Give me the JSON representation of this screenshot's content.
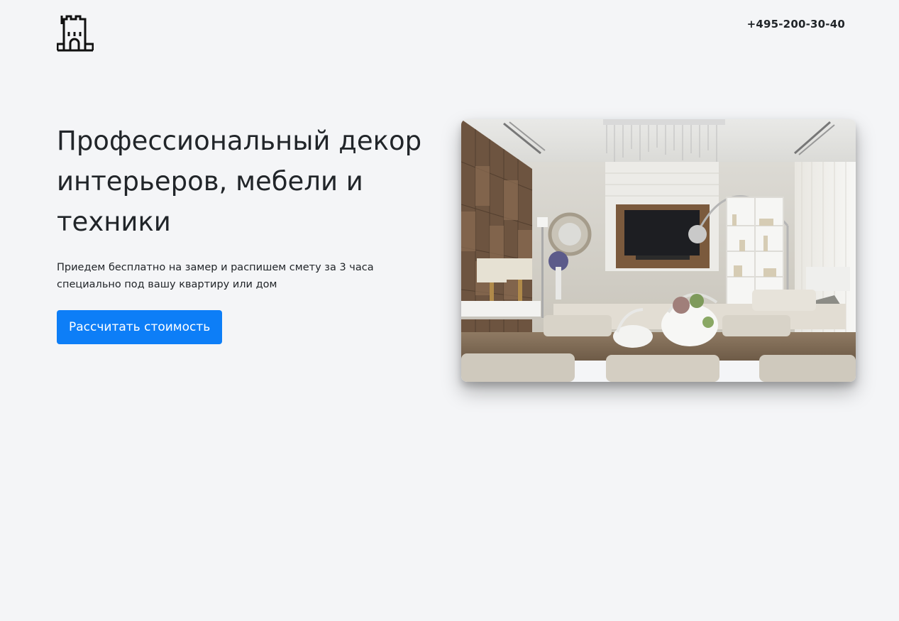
{
  "header": {
    "logo_icon": "castle-icon",
    "phone": "+495-200-30-40"
  },
  "hero": {
    "title": "Профессиональный декор интерьеров, мебели и техники",
    "subtitle": "Приедем бесплатно на замер и распишем смету за 3 часа специально под вашу квартиру или дом",
    "cta_label": "Рассчитать стоимость",
    "image_subject": "living-room-interior-photo"
  },
  "colors": {
    "background": "#f4f5f7",
    "accent": "#0d7ef7",
    "text": "#212529"
  }
}
